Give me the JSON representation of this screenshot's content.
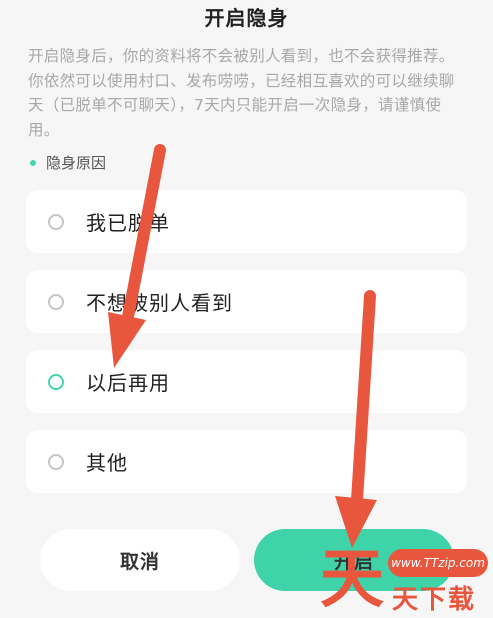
{
  "header": {
    "title": "开启隐身"
  },
  "description": "开启隐身后，你的资料将不会被别人看到，也不会获得推荐。你依然可以使用村口、发布唠唠，已经相互喜欢的可以继续聊天（已脱单不可聊天），7天内只能开启一次隐身，请谨慎使用。",
  "section": {
    "label": "隐身原因"
  },
  "options": [
    {
      "label": "我已脱单",
      "selected": false
    },
    {
      "label": "不想被别人看到",
      "selected": false
    },
    {
      "label": "以后再用",
      "selected": true
    },
    {
      "label": "其他",
      "selected": false
    }
  ],
  "buttons": {
    "cancel": "取消",
    "confirm": "开启"
  },
  "watermark": {
    "site": "www.TTzip.com",
    "big": "天",
    "small": "天下载"
  },
  "colors": {
    "accent": "#3fd3aa",
    "arrow": "#e8563e"
  }
}
